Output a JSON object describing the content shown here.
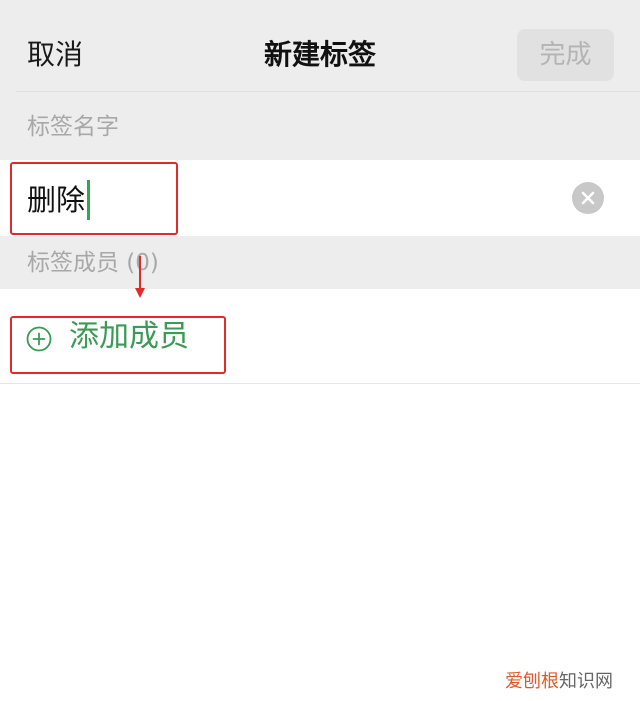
{
  "header": {
    "cancel_label": "取消",
    "title": "新建标签",
    "done_label": "完成"
  },
  "tag_name_section": {
    "label": "标签名字",
    "value": "删除"
  },
  "members_section": {
    "label": "标签成员 (0)",
    "add_label": "添加成员"
  },
  "watermark": {
    "brand": "爱刨根",
    "suffix": "知识网"
  },
  "colors": {
    "accent_green": "#3b9a55",
    "caret_green": "#2ba94e",
    "annotation_red": "#e32a2a"
  },
  "icons": [
    "clear-icon",
    "add-circle-icon",
    "arrow-down-icon"
  ]
}
